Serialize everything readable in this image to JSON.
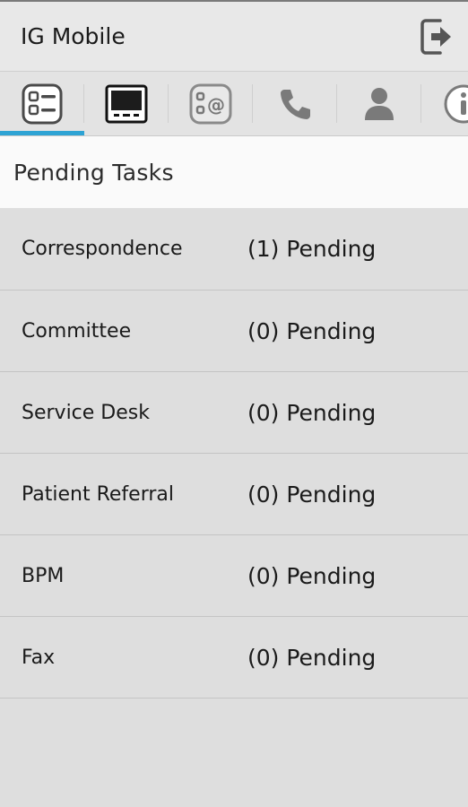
{
  "app": {
    "title": "IG Mobile"
  },
  "action_bar": {
    "logout_icon": "logout-icon"
  },
  "tabs": [
    {
      "icon": "task-list-icon",
      "active": true
    },
    {
      "icon": "monitor-icon",
      "active": false
    },
    {
      "icon": "contact-email-icon",
      "active": false
    },
    {
      "icon": "phone-icon",
      "active": false
    },
    {
      "icon": "person-icon",
      "active": false
    },
    {
      "icon": "info-icon",
      "active": false
    }
  ],
  "section": {
    "title": "Pending Tasks"
  },
  "tasks": [
    {
      "name": "Correspondence",
      "status": "(1) Pending"
    },
    {
      "name": "Committee",
      "status": "(0) Pending"
    },
    {
      "name": "Service Desk",
      "status": "(0) Pending"
    },
    {
      "name": "Patient Referral",
      "status": "(0) Pending"
    },
    {
      "name": "BPM",
      "status": "(0) Pending"
    },
    {
      "name": "Fax",
      "status": "(0) Pending"
    }
  ],
  "colors": {
    "accent": "#2ea3d4",
    "background": "#dedede",
    "header_background": "#fafafa"
  }
}
